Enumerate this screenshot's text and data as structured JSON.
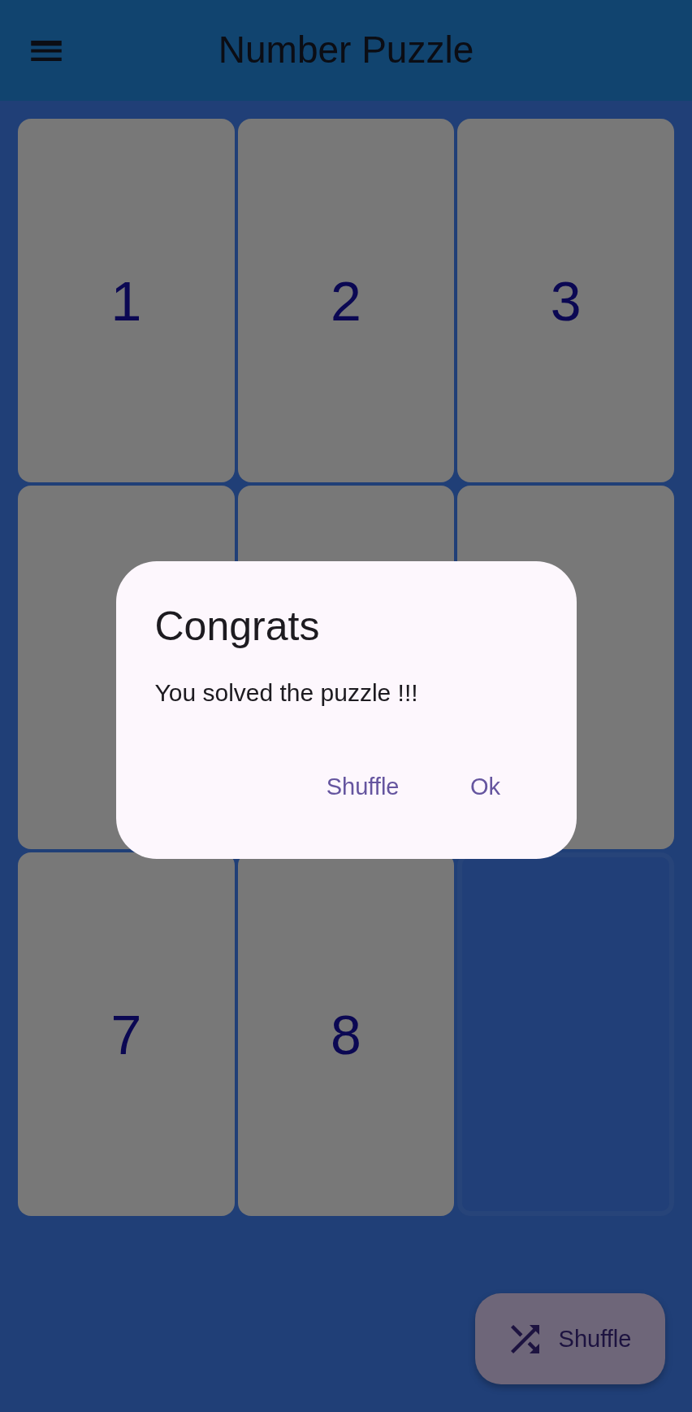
{
  "app_bar": {
    "title": "Number Puzzle"
  },
  "board": {
    "tiles": [
      {
        "kind": "tile",
        "label": "1"
      },
      {
        "kind": "tile",
        "label": "2"
      },
      {
        "kind": "tile",
        "label": "3"
      },
      {
        "kind": "tile"
      },
      {
        "kind": "tile"
      },
      {
        "kind": "tile"
      },
      {
        "kind": "tile",
        "label": "7"
      },
      {
        "kind": "tile",
        "label": "8"
      },
      {
        "kind": "empty"
      }
    ]
  },
  "dialog": {
    "title": "Congrats",
    "message": "You solved the puzzle !!!",
    "buttons": [
      "Shuffle",
      "Ok"
    ]
  },
  "fab": {
    "label": "Shuffle"
  }
}
